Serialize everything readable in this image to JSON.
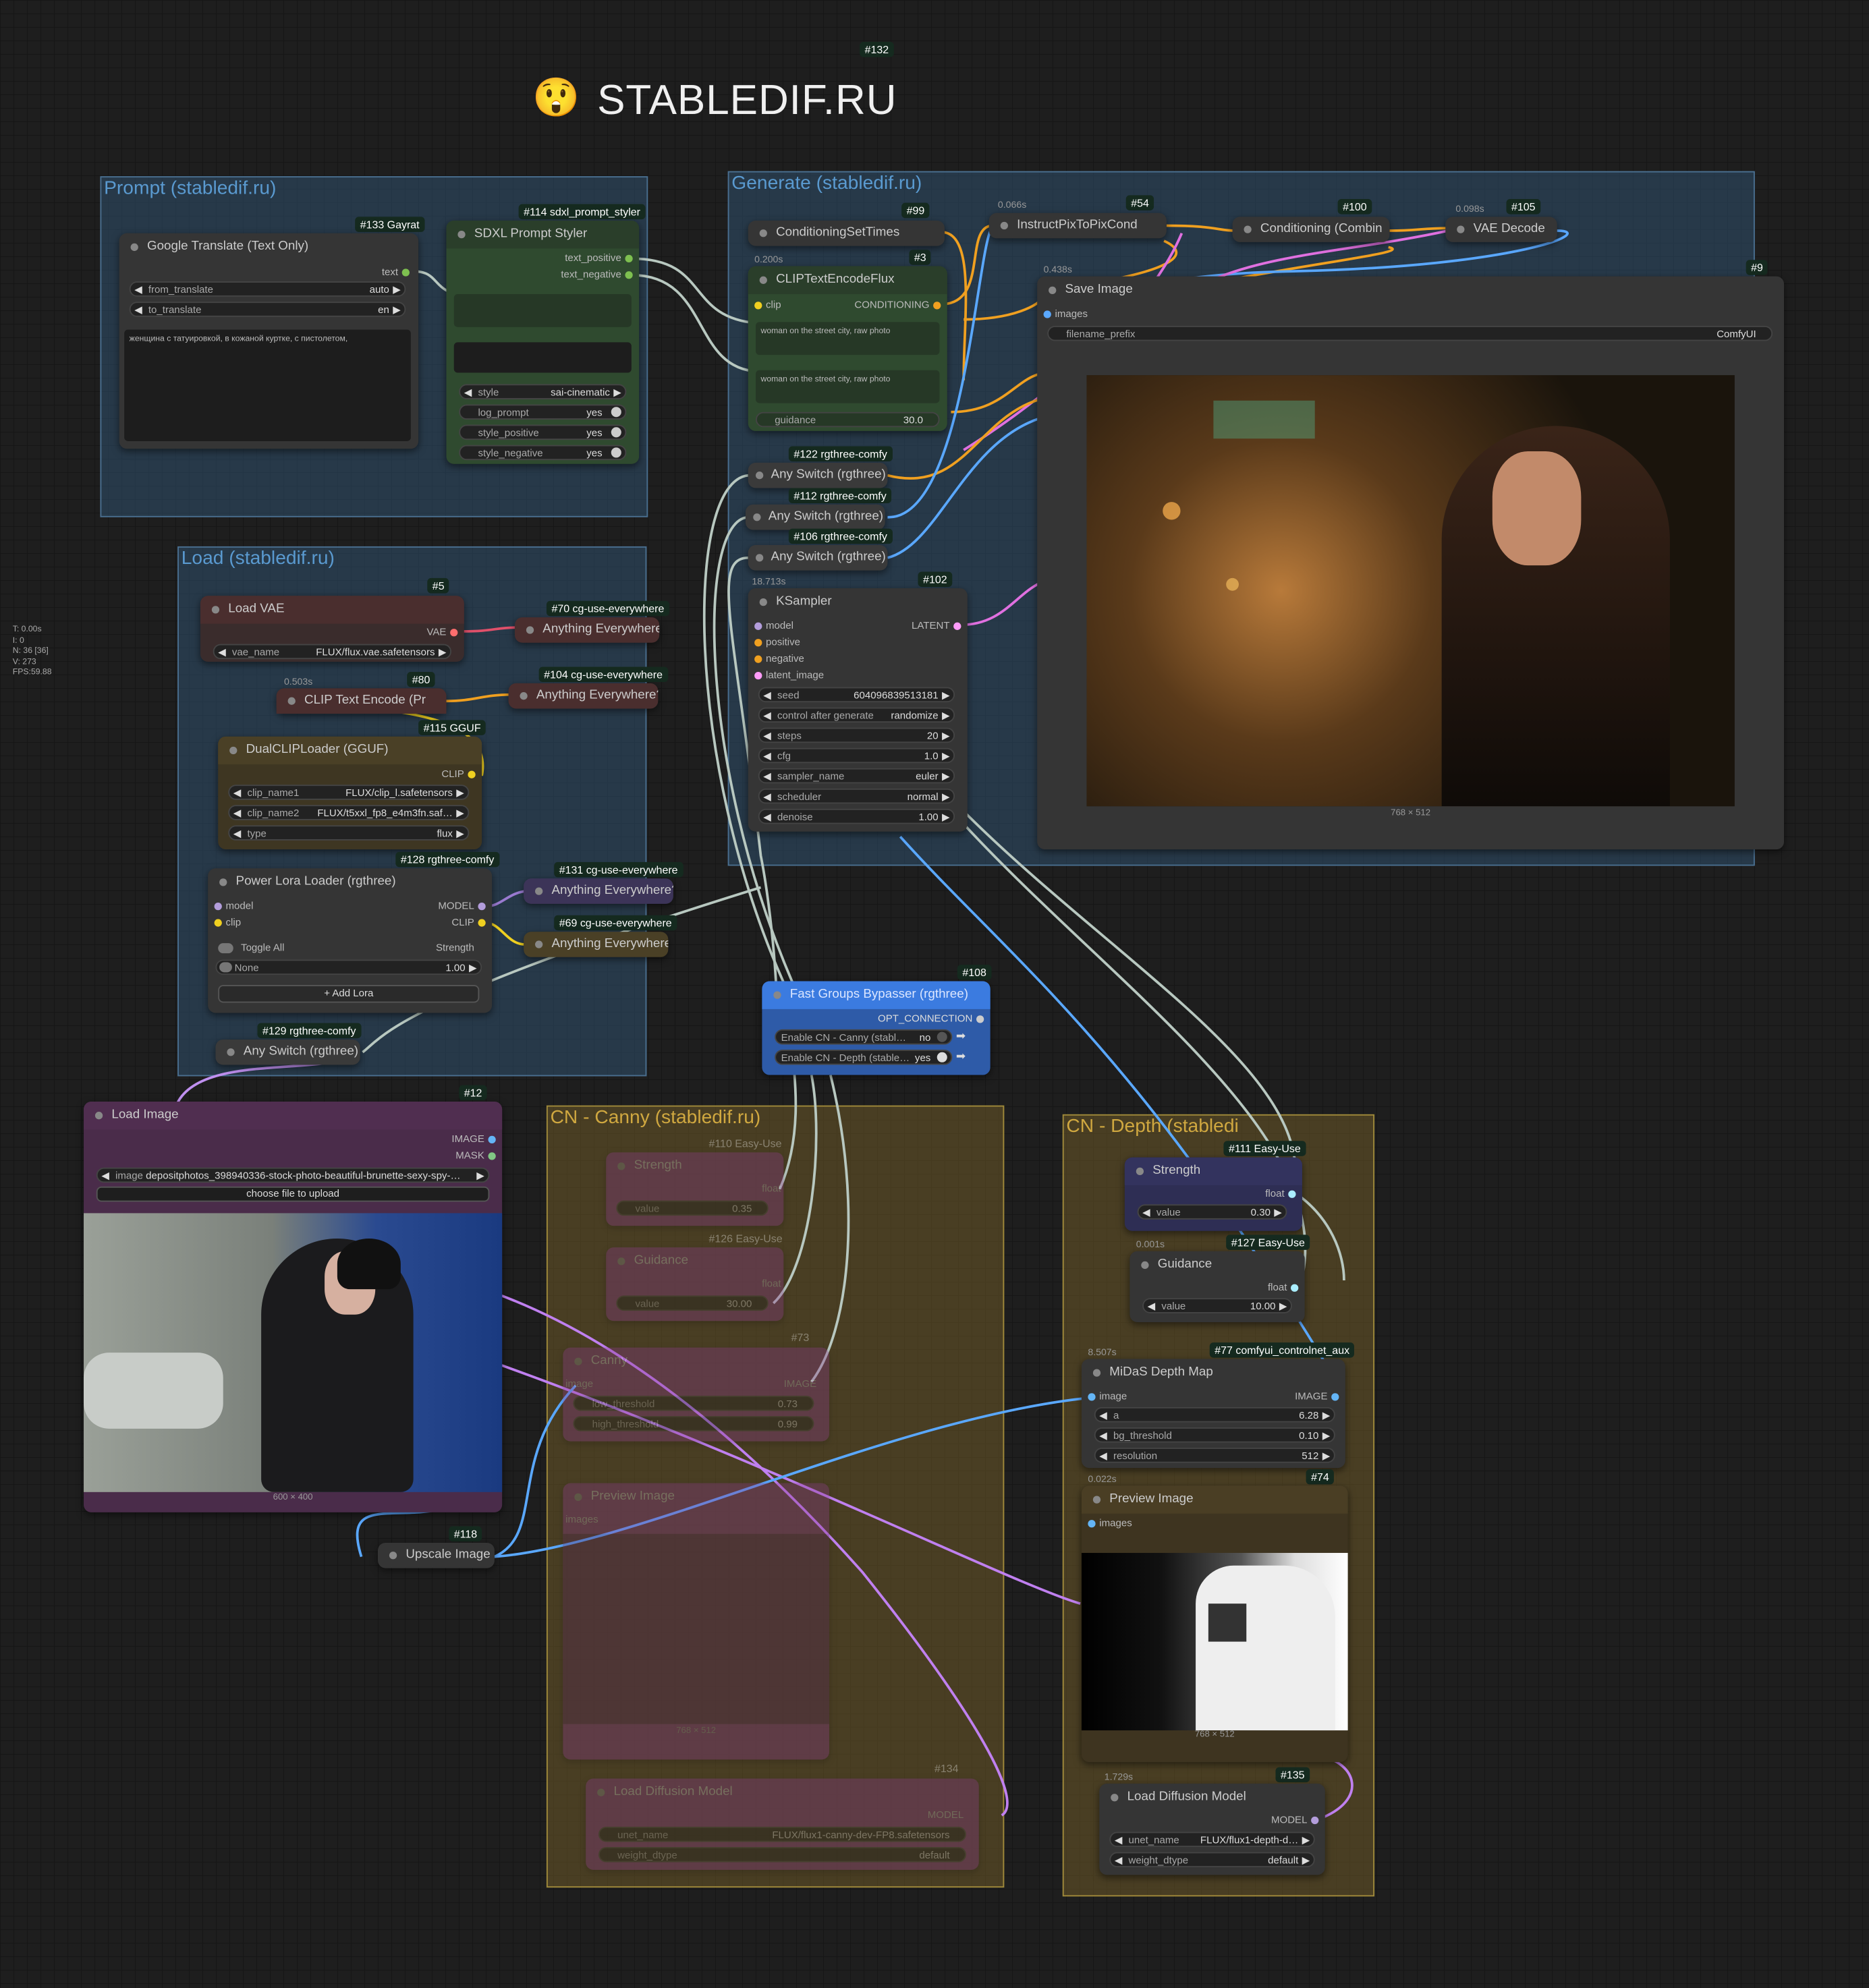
{
  "header": {
    "title": "STABLEDIF.RU",
    "badge": "#132",
    "emoji": "😲"
  },
  "stats": {
    "lines": [
      "T: 0.00s",
      "I: 0",
      "N: 36 [36]",
      "V: 273",
      "FPS:59.88"
    ]
  },
  "groups": {
    "prompt": "Prompt (stabledif.ru)",
    "load": "Load (stabledif.ru)",
    "generate": "Generate (stabledif.ru)",
    "canny": "CN - Canny (stabledif.ru)",
    "depth": "CN - Depth (stabledi"
  },
  "google_translate": {
    "badge": "#133 Gayrat",
    "title": "Google Translate (Text Only)",
    "out": "text",
    "from_label": "from_translate",
    "from_val": "auto",
    "to_label": "to_translate",
    "to_val": "en",
    "text": "женщина с татуировкой, в кожаной куртке, с пистолетом,"
  },
  "sdxl_styler": {
    "badge": "#114 sdxl_prompt_styler",
    "title": "SDXL Prompt Styler",
    "out1": "text_positive",
    "out2": "text_negative",
    "style_label": "style",
    "style_val": "sai-cinematic",
    "log_label": "log_prompt",
    "log_val": "yes",
    "sp_label": "style_positive",
    "sp_val": "yes",
    "sn_label": "style_negative",
    "sn_val": "yes"
  },
  "cond_set_times": {
    "badge": "#99",
    "title": "ConditioningSetTimes"
  },
  "instruct": {
    "timing": "0.066s",
    "badge": "#54",
    "title": "InstructPixToPixCond"
  },
  "cond_combine": {
    "badge": "#100",
    "title": "Conditioning (Combin"
  },
  "vae_decode": {
    "timing": "0.098s",
    "badge": "#105",
    "title": "VAE Decode"
  },
  "clip_flux": {
    "timing": "0.200s",
    "badge": "#3",
    "title": "CLIPTextEncodeFlux",
    "in": "clip",
    "out": "CONDITIONING",
    "text1": "woman on the street city, raw photo",
    "text2": "woman on the street city, raw photo",
    "guidance_label": "guidance",
    "guidance_val": "30.0"
  },
  "save_image": {
    "timing": "0.438s",
    "badge": "#9",
    "title": "Save Image",
    "in": "images",
    "prefix_label": "filename_prefix",
    "prefix_val": "ComfyUI",
    "caption": "768 × 512"
  },
  "any_switch": {
    "b122": "#122 rgthree-comfy",
    "b112": "#112 rgthree-comfy",
    "b106": "#106 rgthree-comfy",
    "title": "Any Switch (rgthree)"
  },
  "ksampler": {
    "timing": "18.713s",
    "badge": "#102",
    "title": "KSampler",
    "in_model": "model",
    "in_pos": "positive",
    "in_neg": "negative",
    "in_latent": "latent_image",
    "out": "LATENT",
    "seed_label": "seed",
    "seed_val": "604096839513181",
    "cag_label": "control after generate",
    "cag_val": "randomize",
    "steps_label": "steps",
    "steps_val": "20",
    "cfg_label": "cfg",
    "cfg_val": "1.0",
    "sampler_label": "sampler_name",
    "sampler_val": "euler",
    "sched_label": "scheduler",
    "sched_val": "normal",
    "denoise_label": "denoise",
    "denoise_val": "1.00"
  },
  "load_vae": {
    "badge": "#5",
    "title": "Load VAE",
    "out": "VAE",
    "name_label": "vae_name",
    "name_val": "FLUX/flux.vae.safetensors"
  },
  "ae70": {
    "badge": "#70 cg-use-everywhere",
    "title": "Anything Everywhere"
  },
  "clip_text_80": {
    "timing": "0.503s",
    "badge": "#80",
    "title": "CLIP Text Encode (Pr"
  },
  "ae104": {
    "badge": "#104 cg-use-everywhere",
    "title": "Anything Everywhere?"
  },
  "dual_clip": {
    "badge": "#115 GGUF",
    "title": "DualCLIPLoader (GGUF)",
    "out": "CLIP",
    "c1_label": "clip_name1",
    "c1_val": "FLUX/clip_l.safetensors",
    "c2_label": "clip_name2",
    "c2_val": "FLUX/t5xxl_fp8_e4m3fn.saf…",
    "type_label": "type",
    "type_val": "flux"
  },
  "power_lora": {
    "badge": "#128 rgthree-comfy",
    "title": "Power Lora Loader (rgthree)",
    "in_model": "model",
    "in_clip": "clip",
    "out_model": "MODEL",
    "out_clip": "CLIP",
    "toggle_all": "Toggle All",
    "strength": "Strength",
    "none": "None",
    "none_val": "1.00",
    "add": "+ Add Lora"
  },
  "ae131": {
    "badge": "#131 cg-use-everywhere",
    "title": "Anything Everywhere?"
  },
  "ae69": {
    "badge": "#69 cg-use-everywhere",
    "title": "Anything Everywhere"
  },
  "any129": {
    "badge": "#129 rgthree-comfy",
    "title": "Any Switch (rgthree)"
  },
  "load_image": {
    "badge": "#12",
    "title": "Load Image",
    "out1": "IMAGE",
    "out2": "MASK",
    "image_label": "image",
    "image_val": "depositphotos_398940336-stock-photo-beautiful-brunette-sexy-spy-…",
    "upload": "choose file to upload",
    "caption": "600 × 400"
  },
  "upscale": {
    "badge": "#118",
    "title": "Upscale Image"
  },
  "bypasser": {
    "badge": "#108",
    "title": "Fast Groups Bypasser (rgthree)",
    "out": "OPT_CONNECTION",
    "r1_label": "Enable CN - Canny (stabl…",
    "r1_val": "no",
    "r2_label": "Enable CN - Depth (stable…",
    "r2_val": "yes"
  },
  "canny": {
    "b110": "#110 Easy-Use",
    "strength": "Strength",
    "float": "float",
    "value": "value",
    "s_val": "0.35",
    "b126": "#126 Easy-Use",
    "guidance": "Guidance",
    "g_val": "30.00",
    "b73": "#73",
    "canny_title": "Canny",
    "image": "image",
    "IMAGE": "IMAGE",
    "low": "low_threshold",
    "low_val": "0.73",
    "high": "high_threshold",
    "high_val": "0.99",
    "preview": "Preview Image",
    "images": "images",
    "caption": "768 × 512",
    "b134": "#134",
    "ldm": "Load Diffusion Model",
    "MODEL": "MODEL",
    "unet": "unet_name",
    "unet_val": "FLUX/flux1-canny-dev-FP8.safetensors",
    "wd": "weight_dtype",
    "wd_val": "default"
  },
  "depth": {
    "b111": "#111 Easy-Use",
    "strength": "Strength",
    "float": "float",
    "value": "value",
    "s_val": "0.30",
    "timing127": "0.001s",
    "b127": "#127 Easy-Use",
    "guidance": "Guidance",
    "g_val": "10.00",
    "timing77": "8.507s",
    "b77": "#77 comfyui_controlnet_aux",
    "midas": "MiDaS Depth Map",
    "image": "image",
    "IMAGE": "IMAGE",
    "a": "a",
    "a_val": "6.28",
    "bg": "bg_threshold",
    "bg_val": "0.10",
    "res": "resolution",
    "res_val": "512",
    "timing74": "0.022s",
    "b74": "#74",
    "preview": "Preview Image",
    "images": "images",
    "caption": "768 × 512",
    "timing135": "1.729s",
    "b135": "#135",
    "ldm": "Load Diffusion Model",
    "MODEL": "MODEL",
    "unet": "unet_name",
    "unet_val": "FLUX/flux1-depth-d…",
    "wd": "weight_dtype",
    "wd_val": "default"
  },
  "colors": {
    "background": "#1e1e1e",
    "accent_blue": "#3b7be0",
    "wire_blue": "#5aa8ff",
    "wire_orange": "#f0a020",
    "wire_pink": "#e070e0",
    "wire_grey": "#b8c8c0"
  }
}
